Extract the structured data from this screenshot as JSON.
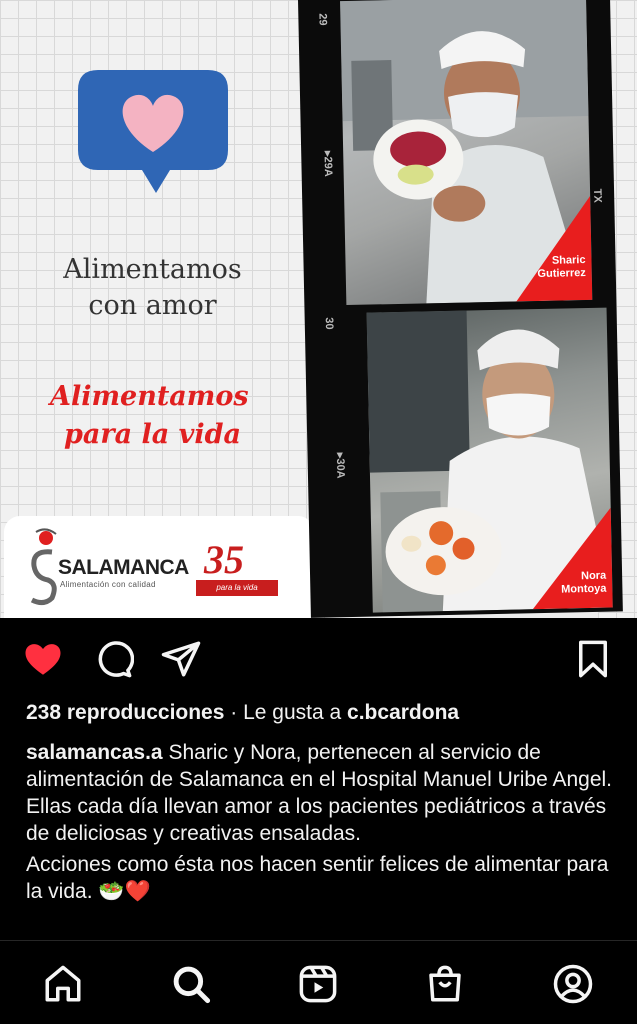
{
  "post": {
    "headline_line1": "Alimentamos",
    "headline_line2": "con amor",
    "tagline_line1": "Alimentamos",
    "tagline_line2": "para la vida",
    "logo_name": "SALAMANCA",
    "logo_sub": "Alimentación con calidad",
    "anniversary_number": "35",
    "anniversary_ribbon": "para la vida",
    "film_numbers": [
      "29",
      "▸29A",
      "30",
      "▸30A",
      "TX"
    ],
    "person1_name_line1": "Sharic",
    "person1_name_line2": "Gutierrez",
    "person2_name_line1": "Nora",
    "person2_name_line2": "Montoya"
  },
  "actions": {
    "like_icon": "heart-filled-icon",
    "comment_icon": "comment-icon",
    "share_icon": "send-icon",
    "save_icon": "bookmark-icon"
  },
  "stats": {
    "plays": "238 reproducciones",
    "separator": "·",
    "liked_by_prefix": "Le gusta a",
    "liked_by_user": "c.bcardona"
  },
  "caption": {
    "username": "salamancas.a",
    "text": "Sharic y Nora, pertenecen al servicio de alimentación de Salamanca en el Hospital Manuel Uribe Angel. Ellas cada día llevan amor a los pacientes pediátricos a través de deliciosas y creativas ensaladas.",
    "text2": "Acciones como ésta nos hacen sentir felices de alimentar para la vida.",
    "emoji": "🥗❤️"
  },
  "nav": [
    "home-icon",
    "search-icon",
    "reels-icon",
    "shop-icon",
    "profile-icon"
  ],
  "colors": {
    "like": "#ff3040",
    "brand_red": "#e02020",
    "bubble_blue": "#2f66b5",
    "bubble_heart": "#f4b3c2"
  }
}
